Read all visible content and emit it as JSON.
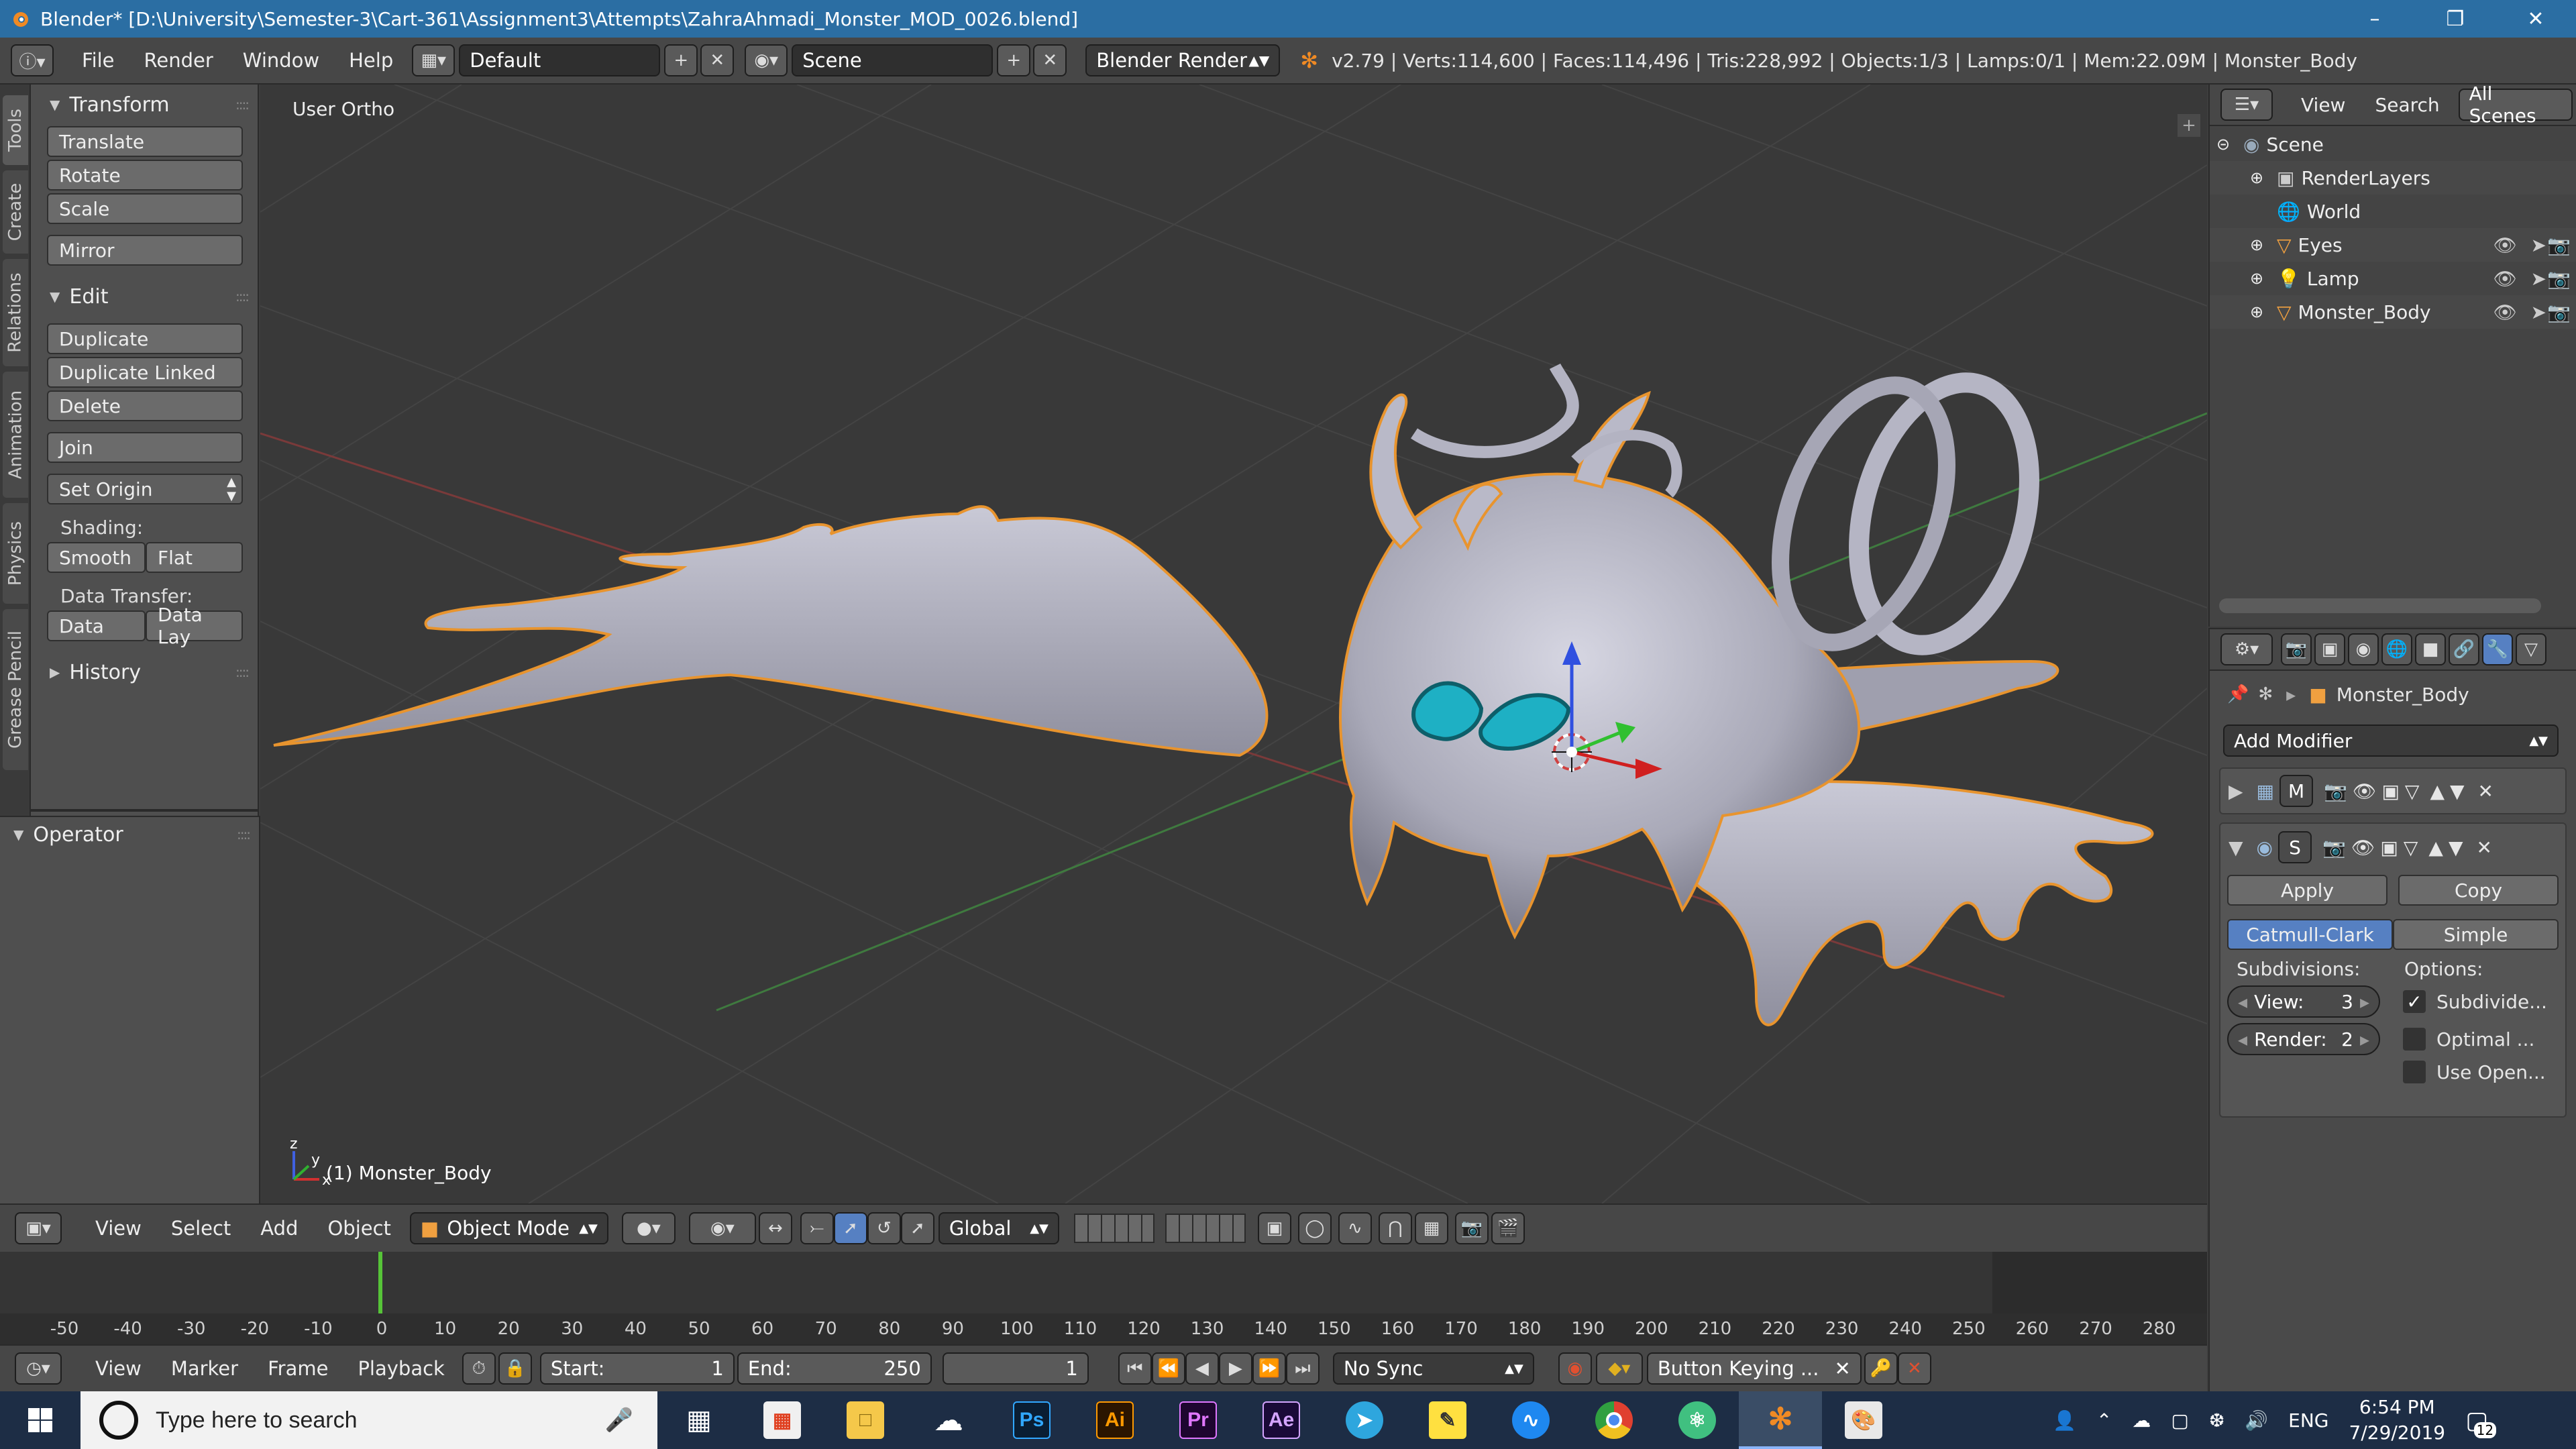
{
  "window": {
    "title": "Blender* [D:\\University\\Semester-3\\Cart-361\\Assignment3\\Attempts\\ZahraAhmadi_Monster_MOD_0026.blend]",
    "minimize_icon": "minimize-icon",
    "maximize_icon": "maximize-icon",
    "close_icon": "close-icon"
  },
  "menubar": {
    "menus": [
      "File",
      "Render",
      "Window",
      "Help"
    ],
    "layout": "Default",
    "scene": "Scene",
    "engine": "Blender Render",
    "stats": "v2.79 | Verts:114,600 | Faces:114,496 | Tris:228,992 | Objects:1/3 | Lamps:0/1 | Mem:22.09M | Monster_Body"
  },
  "left_tabs": [
    "Tools",
    "Create",
    "Relations",
    "Animation",
    "Physics",
    "Grease Pencil"
  ],
  "tool_panel": {
    "transform": {
      "header": "Transform",
      "buttons": [
        "Translate",
        "Rotate",
        "Scale",
        "Mirror"
      ]
    },
    "edit": {
      "header": "Edit",
      "buttons": [
        "Duplicate",
        "Duplicate Linked",
        "Delete",
        "Join"
      ],
      "set_origin": "Set Origin",
      "shading_label": "Shading:",
      "smooth": "Smooth",
      "flat": "Flat",
      "data_transfer_label": "Data Transfer:",
      "data": "Data",
      "data_lay": "Data Lay"
    },
    "history": {
      "header": "History"
    },
    "operator": {
      "header": "Operator"
    }
  },
  "viewport": {
    "view_label": "User Ortho",
    "object_label": "(1) Monster_Body"
  },
  "view3d_header": {
    "menus": [
      "View",
      "Select",
      "Add",
      "Object"
    ],
    "mode": "Object Mode",
    "orientation": "Global"
  },
  "timeline": {
    "ticks": [
      "-50",
      "-40",
      "-30",
      "-20",
      "-10",
      "0",
      "10",
      "20",
      "30",
      "40",
      "50",
      "60",
      "70",
      "80",
      "90",
      "100",
      "110",
      "120",
      "130",
      "140",
      "150",
      "160",
      "170",
      "180",
      "190",
      "200",
      "210",
      "220",
      "230",
      "240",
      "250",
      "260",
      "270",
      "280"
    ],
    "current_frame": 1
  },
  "timeline_header": {
    "menus": [
      "View",
      "Marker",
      "Frame",
      "Playback"
    ],
    "start_label": "Start:",
    "start_value": "1",
    "end_label": "End:",
    "end_value": "250",
    "current_value": "1",
    "sync": "No Sync",
    "keying": "Button Keying ..."
  },
  "outliner": {
    "menus": [
      "View",
      "Search"
    ],
    "all_scenes": "All Scenes",
    "items": [
      {
        "label": "Scene",
        "indent": 0
      },
      {
        "label": "RenderLayers",
        "indent": 1
      },
      {
        "label": "World",
        "indent": 1
      },
      {
        "label": "Eyes",
        "indent": 1
      },
      {
        "label": "Lamp",
        "indent": 1
      },
      {
        "label": "Monster_Body",
        "indent": 1
      }
    ]
  },
  "properties": {
    "object_name": "Monster_Body",
    "add_modifier": "Add Modifier",
    "mod1_letter": "M",
    "mod2_letter": "S",
    "apply": "Apply",
    "copy": "Copy",
    "catmull": "Catmull-Clark",
    "simple": "Simple",
    "subdivisions_label": "Subdivisions:",
    "options_label": "Options:",
    "view_label": "View:",
    "view_value": "3",
    "render_label": "Render:",
    "render_value": "2",
    "opt1": "Subdivide...",
    "opt1_checked": true,
    "opt2": "Optimal ...",
    "opt3": "Use Open..."
  },
  "taskbar": {
    "search_placeholder": "Type here to search",
    "apps": [
      "Ps",
      "Ai",
      "Pr",
      "Ae"
    ],
    "lang": "ENG",
    "time": "6:54 PM",
    "date": "7/29/2019",
    "notifications": "12"
  },
  "colors": {
    "accent_blue": "#5680c2",
    "titlebar": "#2b6ea3",
    "selection_orange": "#f0a040"
  }
}
